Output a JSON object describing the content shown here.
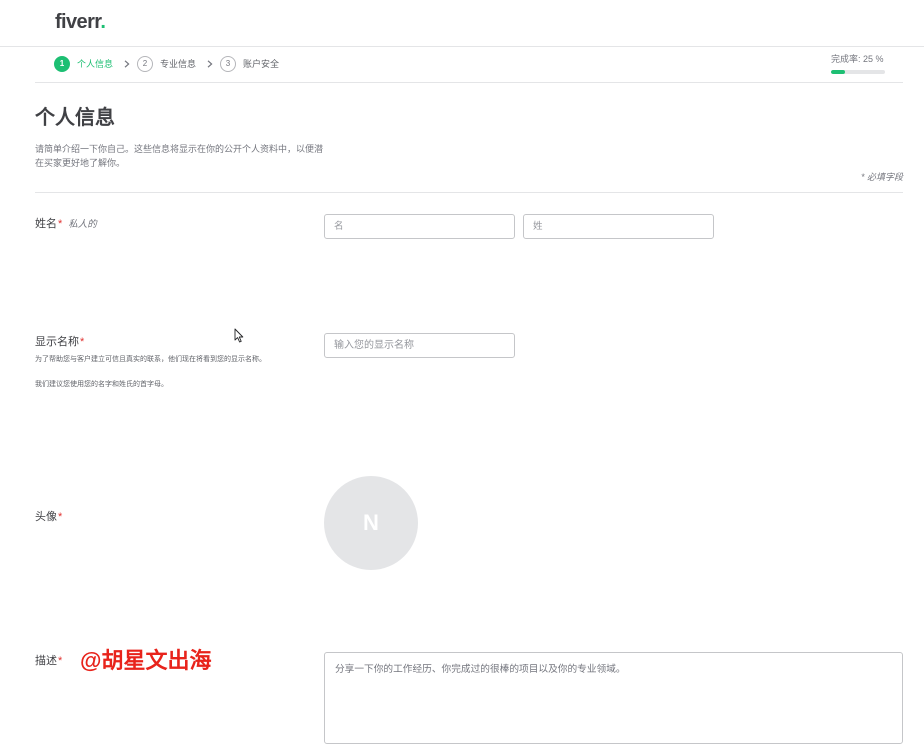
{
  "colors": {
    "brand": "#1dbf73",
    "required": "#e0312f",
    "watermark": "#e8231b"
  },
  "header": {
    "logo_text": "fiverr",
    "logo_dot": "."
  },
  "stepper": {
    "steps": [
      {
        "number": "1",
        "label": "个人信息",
        "active": true
      },
      {
        "number": "2",
        "label": "专业信息",
        "active": false
      },
      {
        "number": "3",
        "label": "账户安全",
        "active": false
      }
    ],
    "completion_label": "完成率: 25 %",
    "completion": 0.25
  },
  "page": {
    "title": "个人信息",
    "description": "请简单介绍一下你自己。这些信息将显示在你的公开个人资料中，以便潜在买家更好地了解你。",
    "required_note": "* 必填字段"
  },
  "form": {
    "name": {
      "label": "姓名",
      "required": "*",
      "note": "私人的",
      "first_placeholder": "名",
      "last_placeholder": "姓"
    },
    "display_name": {
      "label": "显示名称",
      "required": "*",
      "placeholder": "输入您的显示名称",
      "help_1": "为了帮助您与客户建立可信且真实的联系，他们现在将看到您的显示名称。",
      "help_2": "我们建议您使用您的名字和姓氏的首字母。"
    },
    "avatar": {
      "label": "头像",
      "required": "*",
      "initial": "N"
    },
    "description": {
      "label": "描述",
      "required": "*",
      "placeholder": "分享一下你的工作经历、你完成过的很棒的项目以及你的专业领域。"
    }
  },
  "watermark": {
    "text": "@胡星文出海"
  }
}
